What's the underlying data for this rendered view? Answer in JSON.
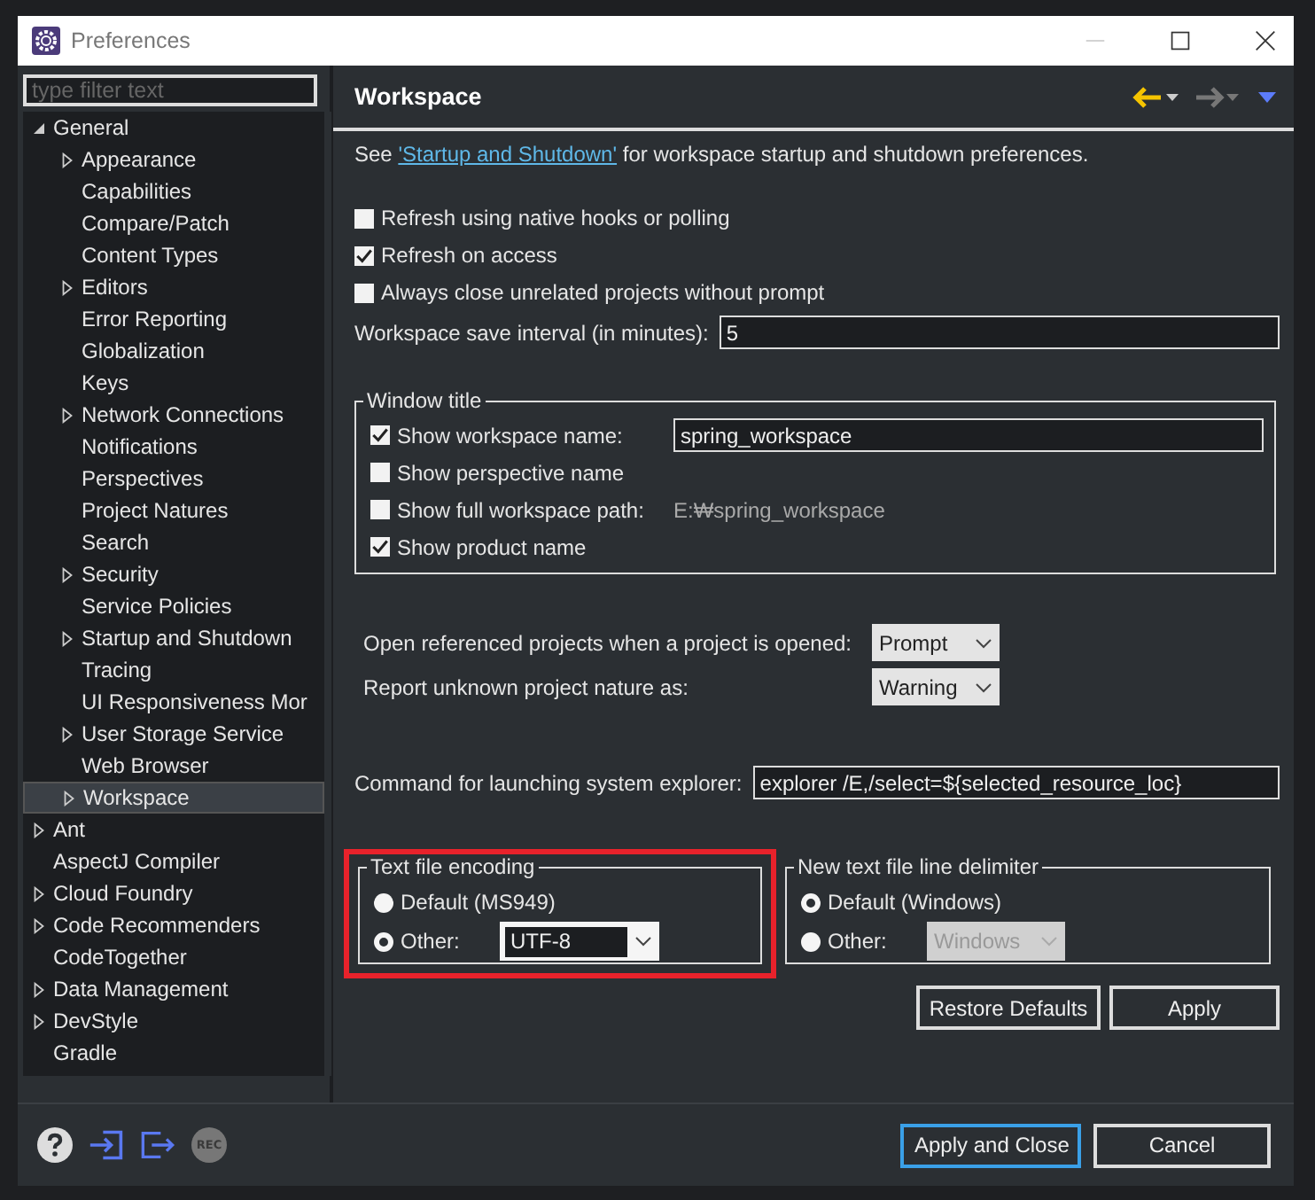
{
  "window": {
    "title": "Preferences"
  },
  "filter": {
    "placeholder": "type filter text"
  },
  "tree": [
    {
      "label": "General",
      "kind": "expanded",
      "selected": false,
      "children": [
        {
          "label": "Appearance",
          "kind": "collapsed",
          "selected": false
        },
        {
          "label": "Capabilities",
          "kind": "leaf",
          "selected": false
        },
        {
          "label": "Compare/Patch",
          "kind": "leaf",
          "selected": false
        },
        {
          "label": "Content Types",
          "kind": "leaf",
          "selected": false
        },
        {
          "label": "Editors",
          "kind": "collapsed",
          "selected": false
        },
        {
          "label": "Error Reporting",
          "kind": "leaf",
          "selected": false
        },
        {
          "label": "Globalization",
          "kind": "leaf",
          "selected": false
        },
        {
          "label": "Keys",
          "kind": "leaf",
          "selected": false
        },
        {
          "label": "Network Connections",
          "kind": "collapsed",
          "selected": false
        },
        {
          "label": "Notifications",
          "kind": "leaf",
          "selected": false
        },
        {
          "label": "Perspectives",
          "kind": "leaf",
          "selected": false
        },
        {
          "label": "Project Natures",
          "kind": "leaf",
          "selected": false
        },
        {
          "label": "Search",
          "kind": "leaf",
          "selected": false
        },
        {
          "label": "Security",
          "kind": "collapsed",
          "selected": false
        },
        {
          "label": "Service Policies",
          "kind": "leaf",
          "selected": false
        },
        {
          "label": "Startup and Shutdown",
          "kind": "collapsed",
          "selected": false
        },
        {
          "label": "Tracing",
          "kind": "leaf",
          "selected": false
        },
        {
          "label": "UI Responsiveness Mor",
          "kind": "leaf",
          "selected": false
        },
        {
          "label": "User Storage Service",
          "kind": "collapsed",
          "selected": false
        },
        {
          "label": "Web Browser",
          "kind": "leaf",
          "selected": false
        },
        {
          "label": "Workspace",
          "kind": "collapsed",
          "selected": true
        }
      ]
    },
    {
      "label": "Ant",
      "kind": "collapsed",
      "selected": false
    },
    {
      "label": "AspectJ Compiler",
      "kind": "leaf",
      "selected": false
    },
    {
      "label": "Cloud Foundry",
      "kind": "collapsed",
      "selected": false
    },
    {
      "label": "Code Recommenders",
      "kind": "collapsed",
      "selected": false
    },
    {
      "label": "CodeTogether",
      "kind": "leaf",
      "selected": false
    },
    {
      "label": "Data Management",
      "kind": "collapsed",
      "selected": false
    },
    {
      "label": "DevStyle",
      "kind": "collapsed",
      "selected": false
    },
    {
      "label": "Gradle",
      "kind": "leaf",
      "selected": false
    }
  ],
  "page": {
    "title": "Workspace",
    "intro_before": "See",
    "intro_link": "'Startup and Shutdown'",
    "intro_after": "for workspace startup and shutdown preferences."
  },
  "checkboxes": [
    {
      "label": "Refresh using native hooks or polling",
      "checked": false
    },
    {
      "label": "Refresh on access",
      "checked": true
    },
    {
      "label": "Always close unrelated projects without prompt",
      "checked": false
    }
  ],
  "save_interval": {
    "label": "Workspace save interval (in minutes):",
    "value": "5"
  },
  "window_title_group": {
    "legend": "Window title",
    "rows": [
      {
        "kind": "field",
        "label": "Show workspace name:",
        "checked": true,
        "value": "spring_workspace"
      },
      {
        "kind": "plain",
        "label": "Show perspective name",
        "checked": false
      },
      {
        "kind": "path",
        "label": "Show full workspace path:",
        "checked": false,
        "value": "E:₩spring_workspace"
      },
      {
        "kind": "plain",
        "label": "Show product name",
        "checked": true
      }
    ]
  },
  "dropdowns": [
    {
      "label": "Open referenced projects when a project is opened:",
      "value": "Prompt"
    },
    {
      "label": "Report unknown project nature as:",
      "value": "Warning"
    }
  ],
  "explorer_command": {
    "label": "Command for launching system explorer:",
    "value": "explorer /E,/select=${selected_resource_loc}"
  },
  "encoding_group": {
    "legend": "Text file encoding",
    "highlighted": true,
    "options": [
      {
        "label": "Default (MS949)",
        "selected": false
      },
      {
        "label": "Other:",
        "selected": true
      }
    ],
    "other_value": "UTF-8",
    "other_disabled": false
  },
  "delimiter_group": {
    "legend": "New text file line delimiter",
    "highlighted": false,
    "options": [
      {
        "label": "Default (Windows)",
        "selected": true
      },
      {
        "label": "Other:",
        "selected": false
      }
    ],
    "other_value": "Windows",
    "other_disabled": true
  },
  "page_buttons": [
    "Restore Defaults",
    "Apply"
  ],
  "footer": {
    "rec_label": "REC",
    "buttons": [
      {
        "label": "Apply and Close",
        "default": true
      },
      {
        "label": "Cancel",
        "default": false
      }
    ]
  }
}
